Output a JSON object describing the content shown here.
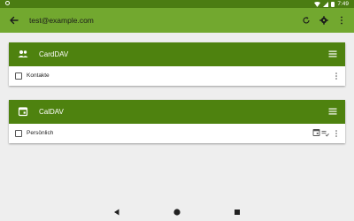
{
  "status_bar": {
    "time": "7:49",
    "icons": [
      "app-notification-icon",
      "wifi-icon",
      "signal-icon",
      "battery-icon"
    ]
  },
  "app_bar": {
    "title": "test@example.com",
    "back_icon": "arrow-back-icon",
    "actions": [
      "sync-icon",
      "settings-icon",
      "overflow-menu-icon"
    ]
  },
  "colors": {
    "status_bar": "#4b7c12",
    "app_bar": "#72a82f",
    "card_header": "#4e820f",
    "background": "#eeeeee"
  },
  "cards": [
    {
      "title": "CardDAV",
      "icon": "contacts-icon",
      "rows": [
        {
          "label": "Kontakte",
          "checked": false
        }
      ]
    },
    {
      "title": "CalDAV",
      "icon": "calendar-icon",
      "rows": [
        {
          "label": "Persönlich",
          "checked": false,
          "extra_icons": [
            "calendar-icon",
            "tasks-icon"
          ]
        }
      ]
    }
  ],
  "nav_bar": {
    "buttons": [
      "back-triangle-icon",
      "home-circle-icon",
      "recents-square-icon"
    ]
  }
}
